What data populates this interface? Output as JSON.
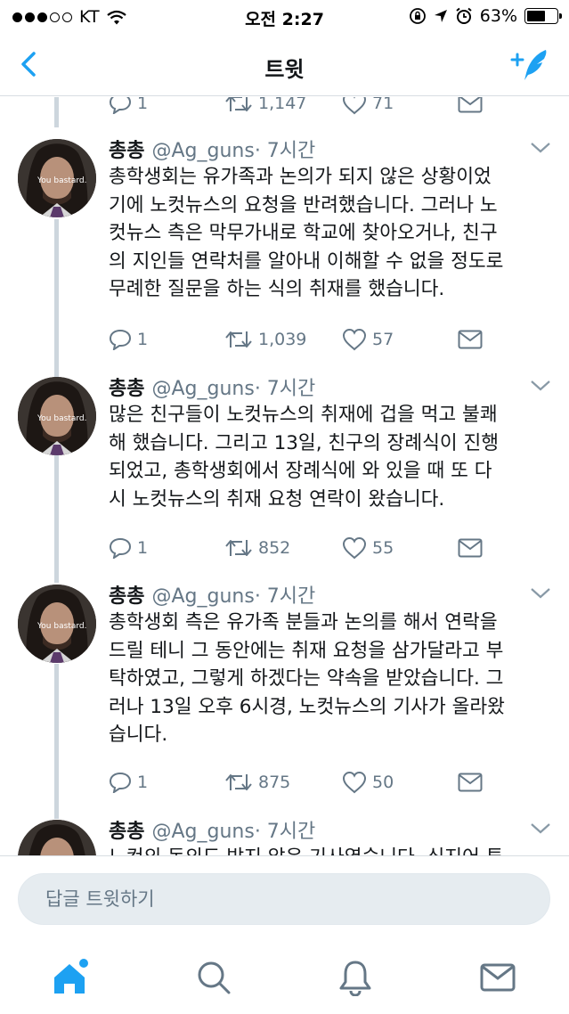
{
  "status_bar": {
    "carrier": "KT",
    "time": "오전 2:27",
    "battery": "63%",
    "battery_level": 0.63
  },
  "nav": {
    "title": "트윗",
    "back_icon": "chevron-left-icon",
    "compose_icon": "compose-tweet-icon"
  },
  "top_actions": {
    "reply_count": "1",
    "retweet_count": "1,147",
    "like_count": "71"
  },
  "tweets": [
    {
      "name": "총총",
      "handle": "@Ag_guns",
      "time": "· 7시간",
      "avatar_text": "You bastard.",
      "lines": [
        "총학생회는 유가족과 논의가 되지 않은 상황이었",
        "기에 노컷뉴스의 요청을 반려했습니다. 그러나 노",
        "컷뉴스 측은 막무가내로 학교에 찾아오거나, 친구",
        "의 지인들 연락처를 알아내 이해할 수 없을 정도로",
        "무례한 질문을 하는 식의 취재를 했습니다."
      ],
      "reply_count": "1",
      "retweet_count": "1,039",
      "like_count": "57"
    },
    {
      "name": "총총",
      "handle": "@Ag_guns",
      "time": "· 7시간",
      "avatar_text": "You bastard.",
      "lines": [
        "많은 친구들이 노컷뉴스의 취재에 겁을 먹고 불쾌",
        "해 했습니다. 그리고 13일, 친구의 장례식이 진행",
        "되었고, 총학생회에서 장례식에 와 있을 때 또 다",
        "시 노컷뉴스의 취재 요청 연락이 왔습니다."
      ],
      "reply_count": "1",
      "retweet_count": "852",
      "like_count": "55"
    },
    {
      "name": "총총",
      "handle": "@Ag_guns",
      "time": "· 7시간",
      "avatar_text": "You bastard.",
      "lines": [
        "총학생회 측은 유가족 분들과 논의를 해서 연락을",
        "드릴 테니 그 동안에는 취재 요청을 삼가달라고 부",
        "탁하였고, 그렇게 하겠다는 약속을 받았습니다. 그",
        "러나 13일 오후 6시경, 노컷뉴스의 기사가 올라왔",
        "습니다."
      ],
      "reply_count": "1",
      "retweet_count": "875",
      "like_count": "50"
    },
    {
      "name": "총총",
      "handle": "@Ag_guns",
      "time": "· 7시간",
      "avatar_text": "",
      "lines": [
        "노컷의 동의도 받지 않은 기사였습니다. 심지어 투"
      ]
    }
  ],
  "reply_bar": {
    "placeholder": "답글 트윗하기"
  },
  "tab_bar": {
    "items": [
      "home-icon",
      "search-icon",
      "notifications-icon",
      "messages-icon"
    ]
  },
  "colors": {
    "accent": "#1da1f2",
    "secondary_text": "#657786",
    "thread_line": "#cdd6dd"
  }
}
